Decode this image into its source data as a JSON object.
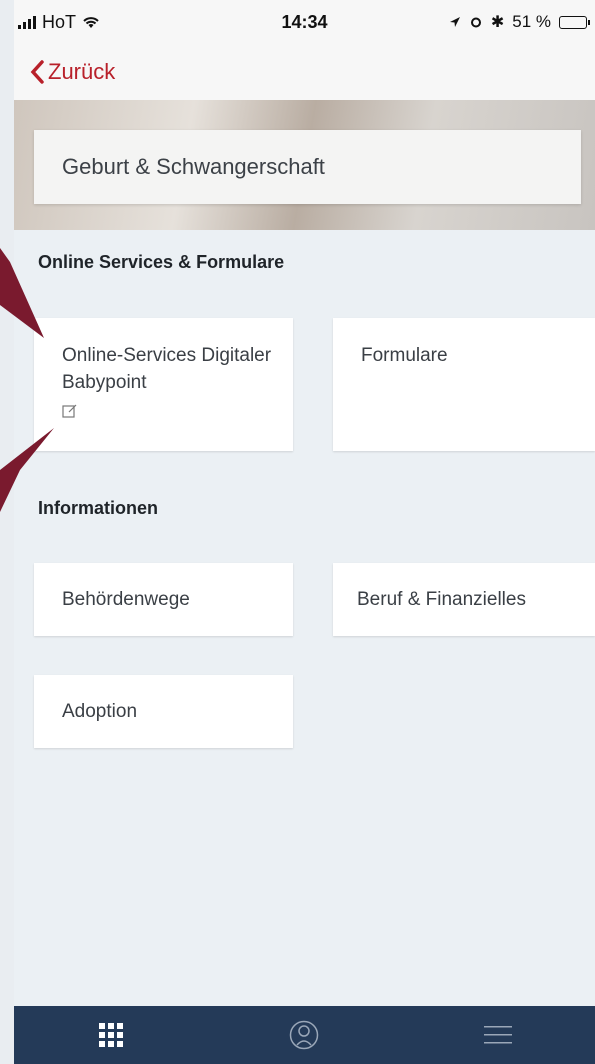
{
  "status": {
    "carrier": "HoT",
    "time": "14:34",
    "battery": "51 %",
    "battery_level": 0.51
  },
  "nav": {
    "back_label": "Zurück"
  },
  "hero": {
    "title": "Geburt & Schwangerschaft"
  },
  "sections": {
    "online": {
      "title": "Online Services & Formulare",
      "tiles": [
        {
          "label": "Online-Services Digitaler Babypoint",
          "external": true
        },
        {
          "label": "Formulare"
        }
      ]
    },
    "info": {
      "title": "Informationen",
      "tiles": [
        {
          "label": "Behördenwege"
        },
        {
          "label": "Beruf & Finanzielles"
        },
        {
          "label": "Adoption"
        }
      ]
    }
  },
  "tabbar": {
    "items": [
      "grid-icon",
      "profile-icon",
      "menu-icon"
    ]
  },
  "colors": {
    "accent": "#b8202a",
    "tabbar": "#243a58",
    "annotation_arrow": "#7a1a2e"
  }
}
